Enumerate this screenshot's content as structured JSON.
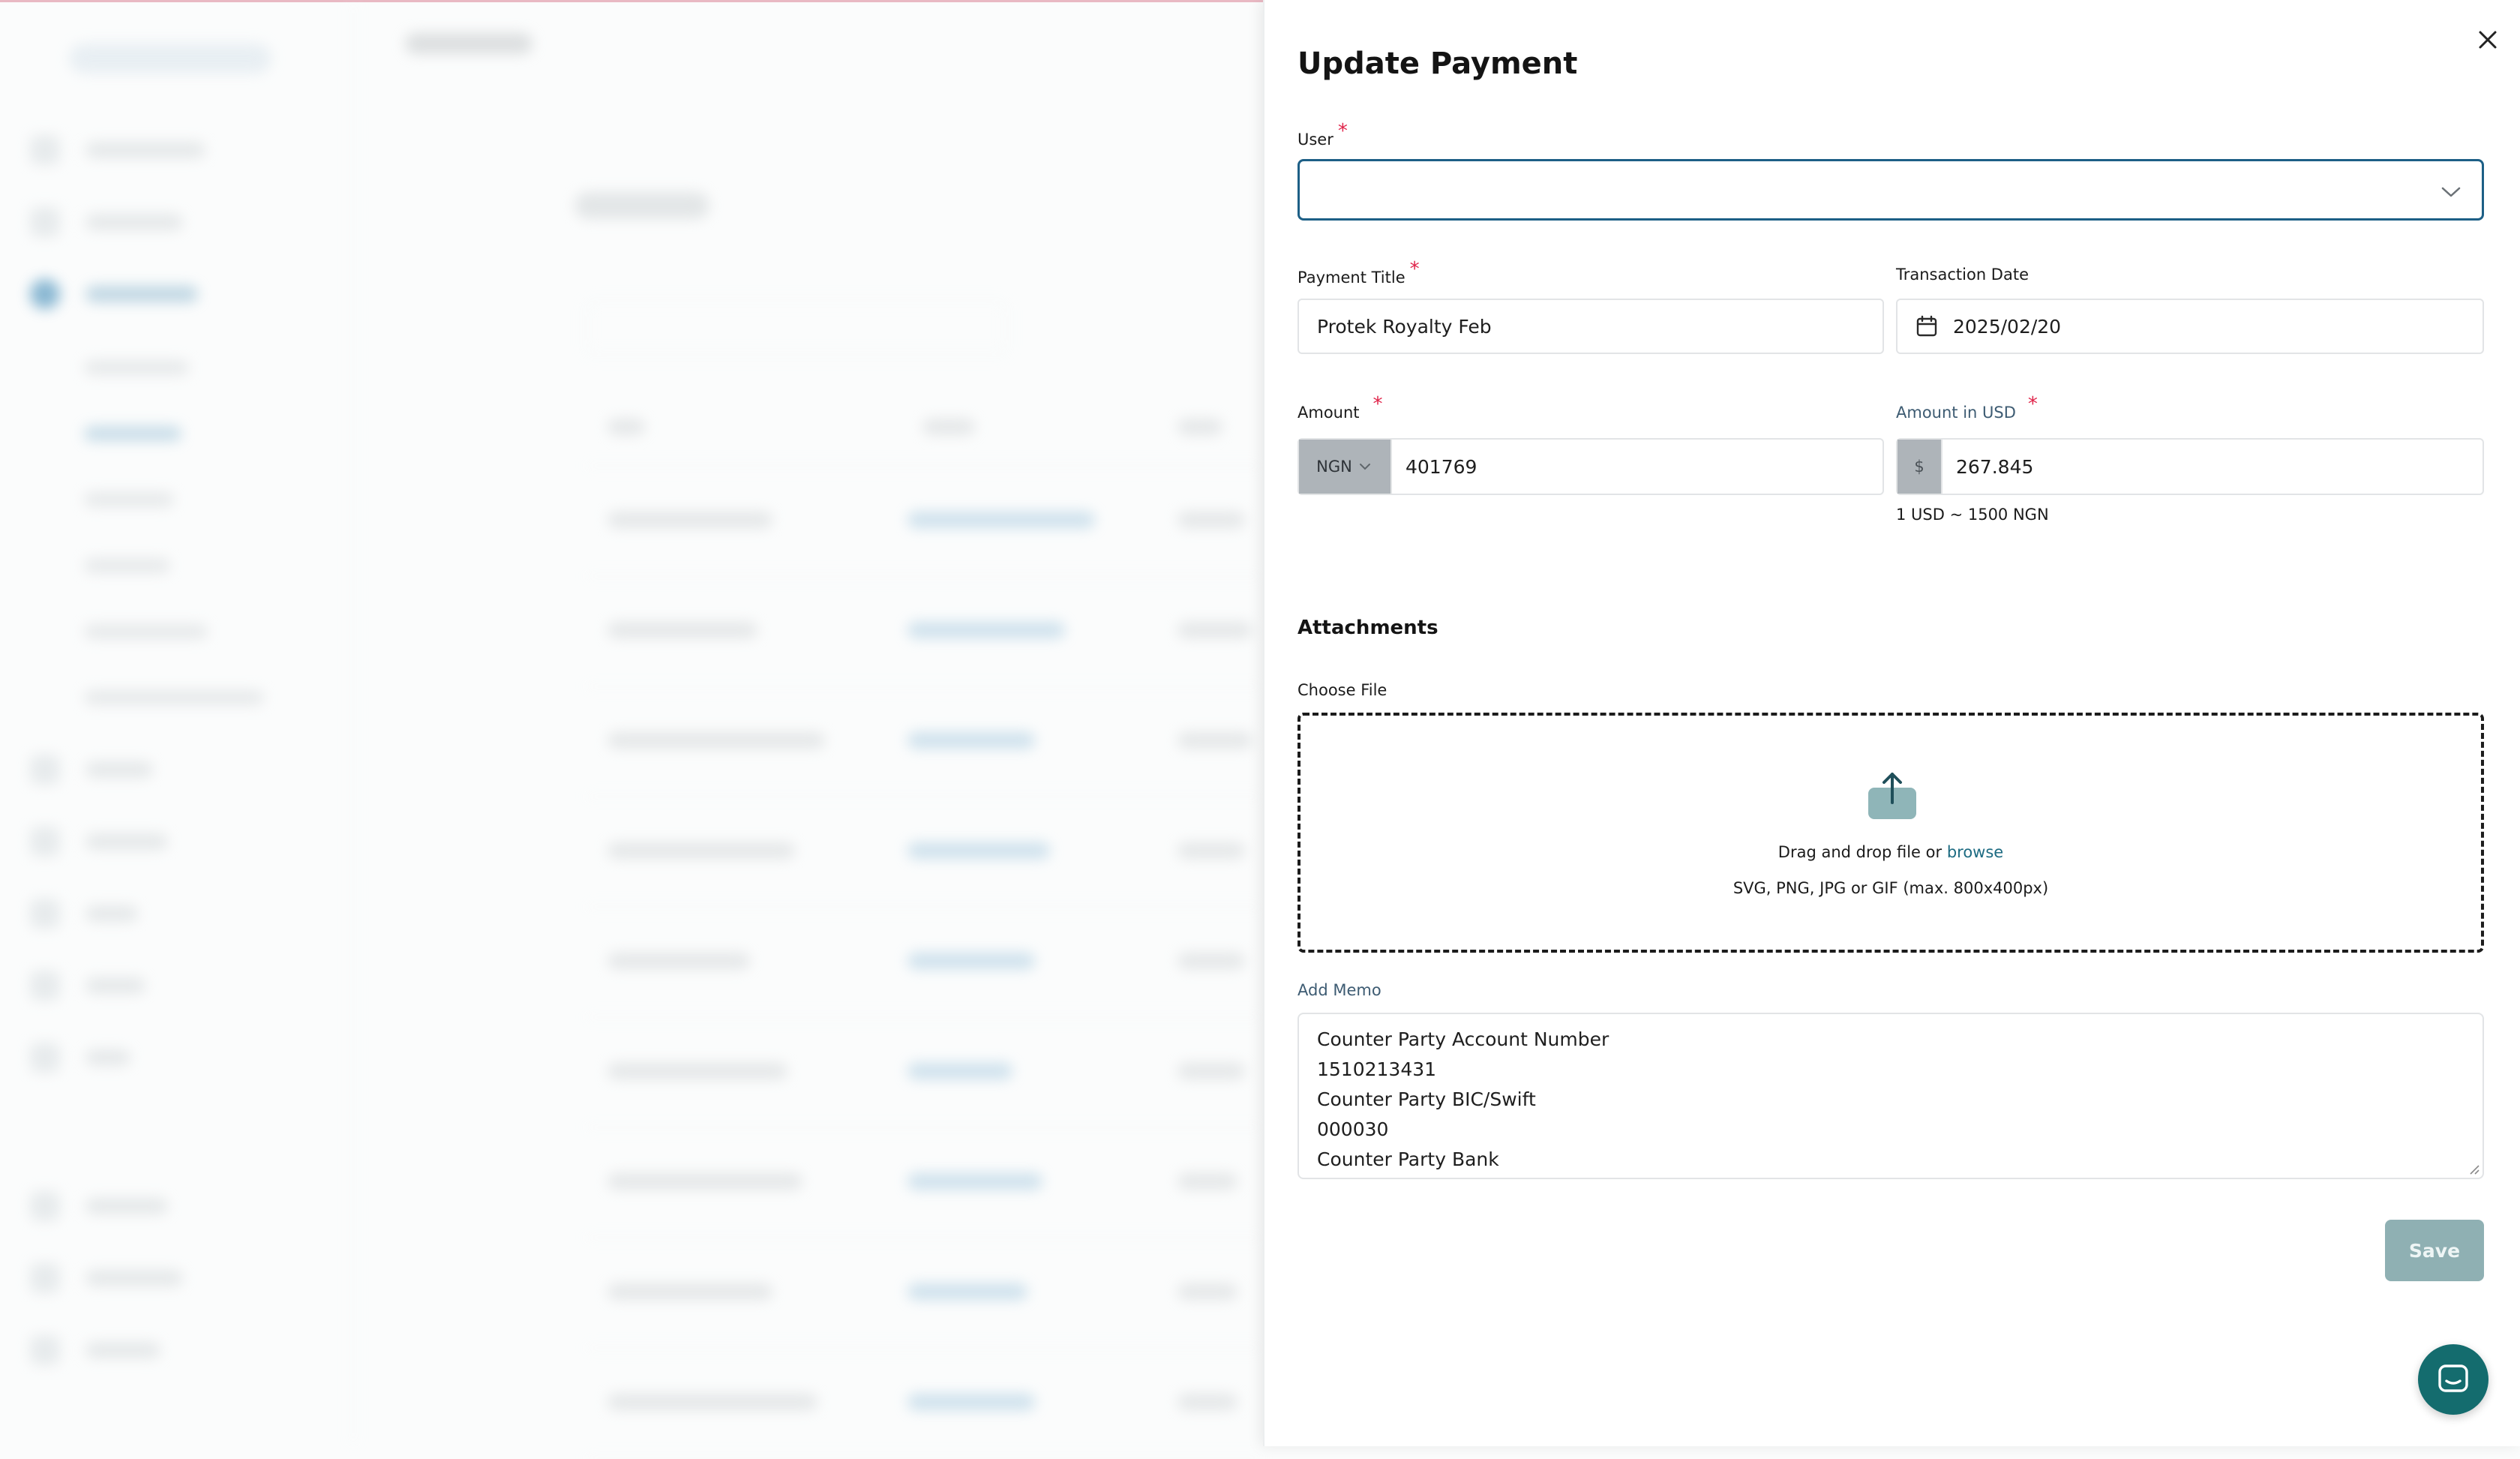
{
  "dialog": {
    "title": "Update Payment",
    "close_icon": "close-icon"
  },
  "user": {
    "label": "User",
    "required": "*",
    "value": ""
  },
  "payment_title": {
    "label": "Payment Title",
    "required": "*",
    "value": "Protek Royalty Feb"
  },
  "transaction_date": {
    "label": "Transaction Date",
    "value": "2025/02/20"
  },
  "amount": {
    "label": "Amount",
    "required": "*",
    "currency": "NGN",
    "value": "401769"
  },
  "amount_usd": {
    "label": "Amount in USD",
    "required": "*",
    "symbol": "$",
    "value": "267.845",
    "rate_note": "1 USD ~ 1500 NGN"
  },
  "attachments": {
    "heading": "Attachments",
    "choose_label": "Choose File",
    "drop_text": "Drag and drop file or",
    "browse": "browse",
    "hint": "SVG, PNG, JPG or GIF (max. 800x400px)"
  },
  "memo": {
    "label": "Add Memo",
    "lines": [
      "Counter Party Account Number",
      "1510213431",
      "Counter Party BIC/Swift",
      "000030",
      "Counter Party Bank"
    ]
  },
  "actions": {
    "save": "Save"
  },
  "colors": {
    "accent": "#1d5f86",
    "save_button": "#8fb0b3",
    "chat_button": "#146c6e",
    "required": "#e0244a"
  }
}
